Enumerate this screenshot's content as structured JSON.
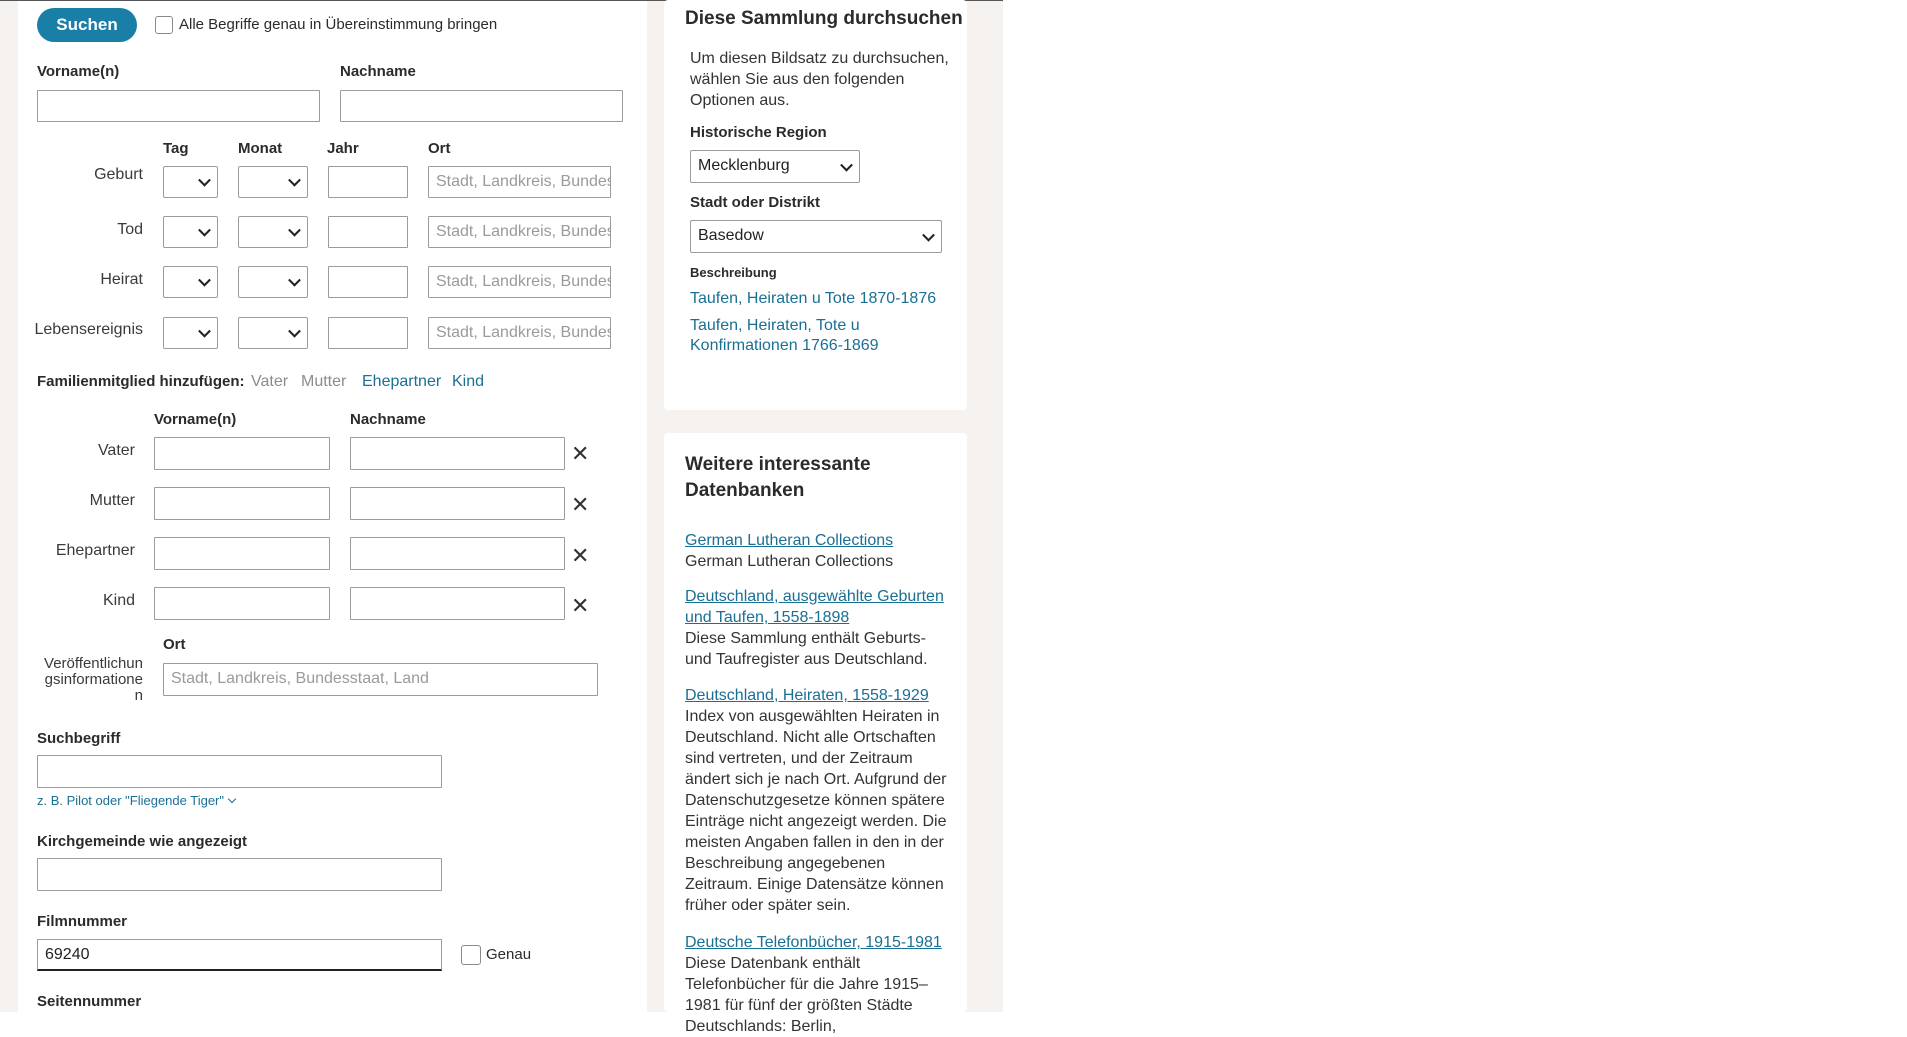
{
  "form": {
    "search_label": "Suchen",
    "exact_all_label": "Alle Begriffe genau in Übereinstimmung bringen",
    "given_names_label": "Vorname(n)",
    "surname_label": "Nachname",
    "events": {
      "col_day": "Tag",
      "col_month": "Monat",
      "col_year": "Jahr",
      "col_place": "Ort",
      "place_placeholder": "Stadt, Landkreis, Bundesstaat, Land",
      "rows": [
        "Geburt",
        "Tod",
        "Heirat",
        "Lebensereignis"
      ]
    },
    "family": {
      "add_label": "Familienmitglied hinzufügen:",
      "links": [
        "Vater",
        "Mutter",
        "Ehepartner",
        "Kind"
      ],
      "col_given": "Vorname(n)",
      "col_surname": "Nachname",
      "rows": [
        "Vater",
        "Mutter",
        "Ehepartner",
        "Kind"
      ]
    },
    "publication": {
      "label_lines": [
        "Veröffentlichun",
        "gsinformatione",
        "n"
      ],
      "place_label": "Ort",
      "place_placeholder": "Stadt, Landkreis, Bundesstaat, Land"
    },
    "keyword_label": "Suchbegriff",
    "keyword_hint": "z. B. Pilot oder \"Fliegende Tiger\"",
    "parish_label": "Kirchgemeinde wie angezeigt",
    "film_label": "Filmnummer",
    "film_value": "69240",
    "film_exact_label": "Genau",
    "page_label": "Seitennummer"
  },
  "browse": {
    "title": "Diese Sammlung durchsuchen",
    "intro": "Um diesen Bildsatz zu durchsuchen, wählen Sie aus den folgenden Optionen aus.",
    "region_label": "Historische Region",
    "region_value": "Mecklenburg",
    "district_label": "Stadt oder Distrikt",
    "district_value": "Basedow",
    "description_label": "Beschreibung",
    "description_links": [
      "Taufen, Heiraten u Tote 1870-1876",
      "Taufen, Heiraten, Tote u Konfirmationen 1766-1869"
    ]
  },
  "related": {
    "title": "Weitere interessante Datenbanken",
    "items": [
      {
        "link": "German Lutheran Collections",
        "text": "German Lutheran Collections"
      },
      {
        "link": "Deutschland, ausgewählte Geburten und Taufen, 1558-1898",
        "text": "Diese Sammlung enthält Geburts- und Taufregister aus Deutschland."
      },
      {
        "link": "Deutschland, Heiraten, 1558-1929",
        "text": "Index von ausgewählten Heiraten in Deutschland. Nicht alle Ortschaften sind vertreten, und der Zeitraum ändert sich je nach Ort. Aufgrund der Datenschutzgesetze können spätere Einträge nicht angezeigt werden. Die meisten Angaben fallen in den in der Beschreibung angegebenen Zeitraum. Einige Datensätze können früher oder später sein."
      },
      {
        "link": "Deutsche Telefonbücher, 1915-1981",
        "text": "Diese Datenbank enthält Telefonbücher für die Jahre 1915–1981 für fünf der größten Städte Deutschlands: Berlin,"
      }
    ]
  },
  "colors": {
    "accent": "#1a7fa6",
    "link": "#1a6f95",
    "page_bg": "#f5f2ef"
  }
}
